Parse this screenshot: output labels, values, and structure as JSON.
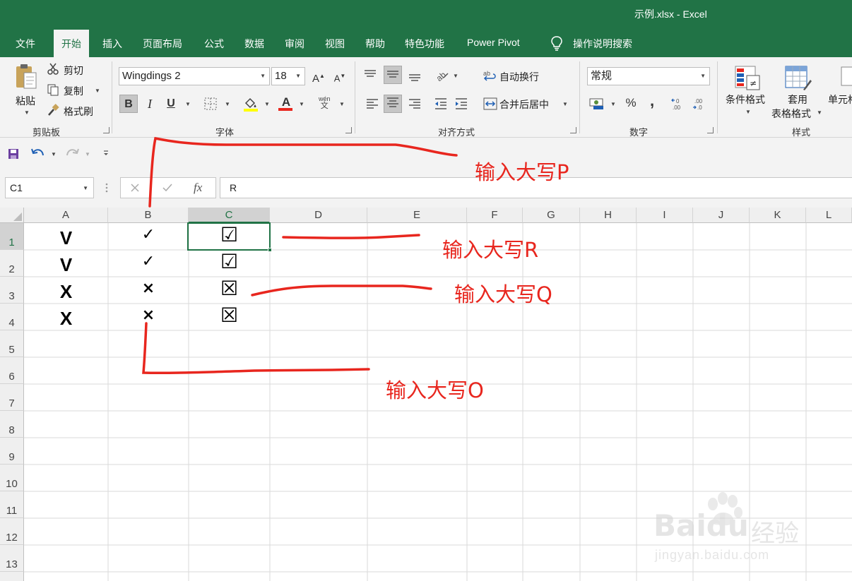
{
  "window": {
    "title": "示例.xlsx  -  Excel"
  },
  "tabs": [
    "文件",
    "开始",
    "插入",
    "页面布局",
    "公式",
    "数据",
    "审阅",
    "视图",
    "帮助",
    "特色功能",
    "Power Pivot",
    "操作说明搜索"
  ],
  "ribbon": {
    "clipboard": {
      "paste": "粘贴",
      "cut": "剪切",
      "copy": "复制",
      "format_painter": "格式刷",
      "label": "剪贴板"
    },
    "font": {
      "font_name": "Wingdings 2",
      "font_size": "18",
      "bold": "B",
      "italic": "I",
      "underline": "U",
      "phonetic_top": "wén",
      "phonetic_bottom": "文",
      "label": "字体"
    },
    "alignment": {
      "wrap_text": "自动换行",
      "merge_center": "合并后居中",
      "label": "对齐方式"
    },
    "number": {
      "format": "常规",
      "percent": "%",
      "comma": ",",
      "label": "数字"
    },
    "styles": {
      "conditional": "条件格式",
      "table_format_1": "套用",
      "table_format_2": "表格格式",
      "cell_styles": "单元格",
      "label": "样式"
    }
  },
  "formula_bar": {
    "name_box": "C1",
    "fx": "fx",
    "formula": "R"
  },
  "columns": [
    "A",
    "B",
    "C",
    "D",
    "E",
    "F",
    "G",
    "H",
    "I",
    "J",
    "K",
    "L"
  ],
  "rows": [
    "1",
    "2",
    "3",
    "4",
    "5",
    "6",
    "7",
    "8",
    "9",
    "10",
    "11",
    "12",
    "13"
  ],
  "cells": {
    "A": [
      "V",
      "V",
      "X",
      "X"
    ],
    "B": [
      "✓",
      "✓",
      "×",
      "×"
    ],
    "C": [
      "☑",
      "☑",
      "☒",
      "☒"
    ]
  },
  "annotations": {
    "p": "输入大写P",
    "r": "输入大写R",
    "q": "输入大写Q",
    "o": "输入大写O"
  },
  "watermark": {
    "brand": "Baidu",
    "brand_cn": "经验",
    "url": "jingyan.baidu.com"
  },
  "colors": {
    "excel_green": "#217346",
    "annotation_red": "#e8261e"
  }
}
